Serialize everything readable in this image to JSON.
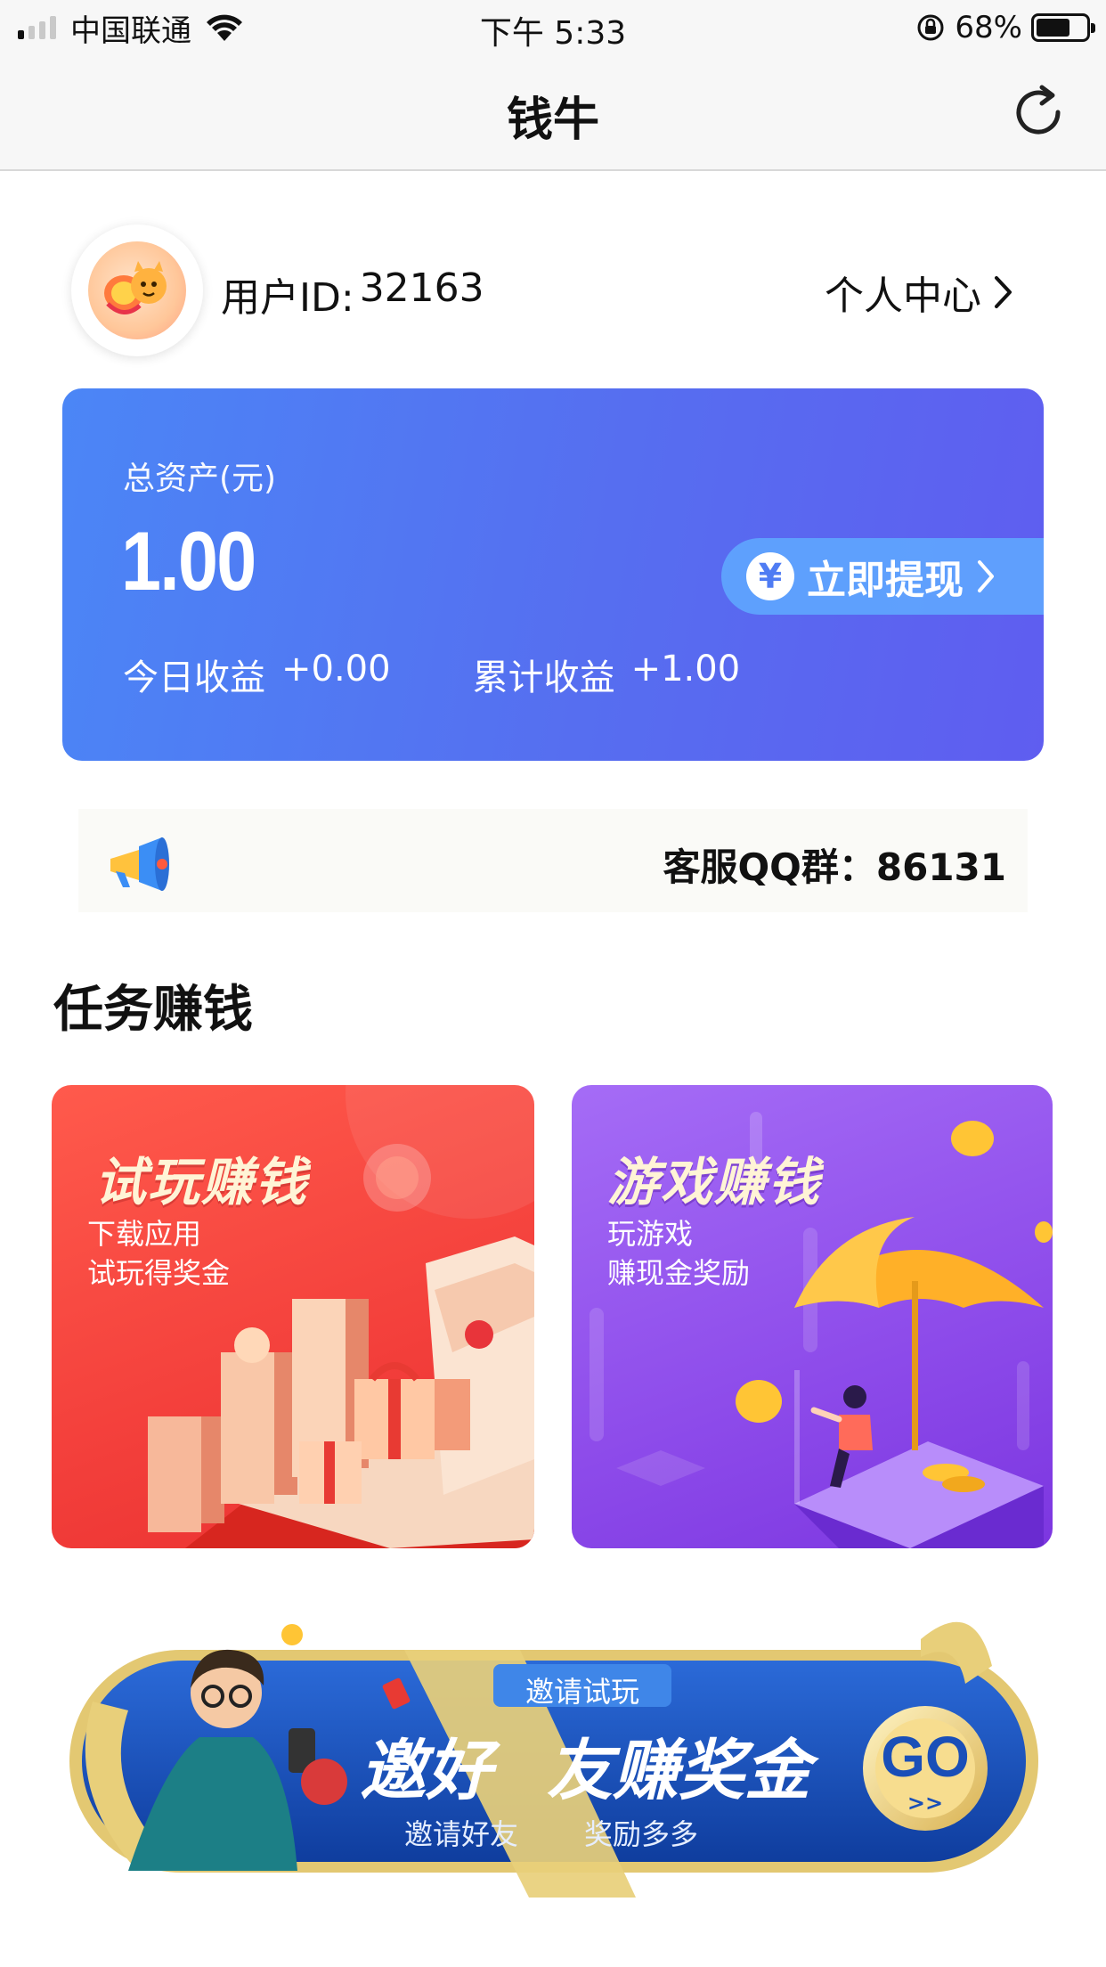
{
  "status_bar": {
    "carrier": "中国联通",
    "time": "下午 5:33",
    "battery_percent": "68%"
  },
  "nav": {
    "title": "钱牛"
  },
  "user": {
    "id_label": "用户ID:",
    "id_value": "32163",
    "personal_center_label": "个人中心"
  },
  "assets": {
    "total_label": "总资产(元)",
    "total_value": "1.00",
    "withdraw_label": "立即提现",
    "today_label": "今日收益",
    "today_value": "+0.00",
    "cumulative_label": "累计收益",
    "cumulative_value": "+1.00"
  },
  "notice": {
    "text": "客服QQ群：86131"
  },
  "section": {
    "title": "任务赚钱"
  },
  "tasks": [
    {
      "title": "试玩赚钱",
      "line1": "下载应用",
      "line2": "试玩得奖金",
      "color": "#f33f3b"
    },
    {
      "title": "游戏赚钱",
      "line1": "玩游戏",
      "line2": "赚现金奖励",
      "color": "#8d4bea"
    }
  ],
  "invite": {
    "tag": "邀请试玩",
    "headline_left": "邀好",
    "headline_right": "友赚奖金",
    "sub_left": "邀请好友",
    "sub_right": "奖励多多",
    "go_label": "GO",
    "go_arrows": ">>"
  },
  "colors": {
    "card_gradient_start": "#4b86f6",
    "card_gradient_end": "#5f5df0",
    "banner_blue": "#1a4fb8",
    "ribbon_gold": "#e8cf7a"
  }
}
